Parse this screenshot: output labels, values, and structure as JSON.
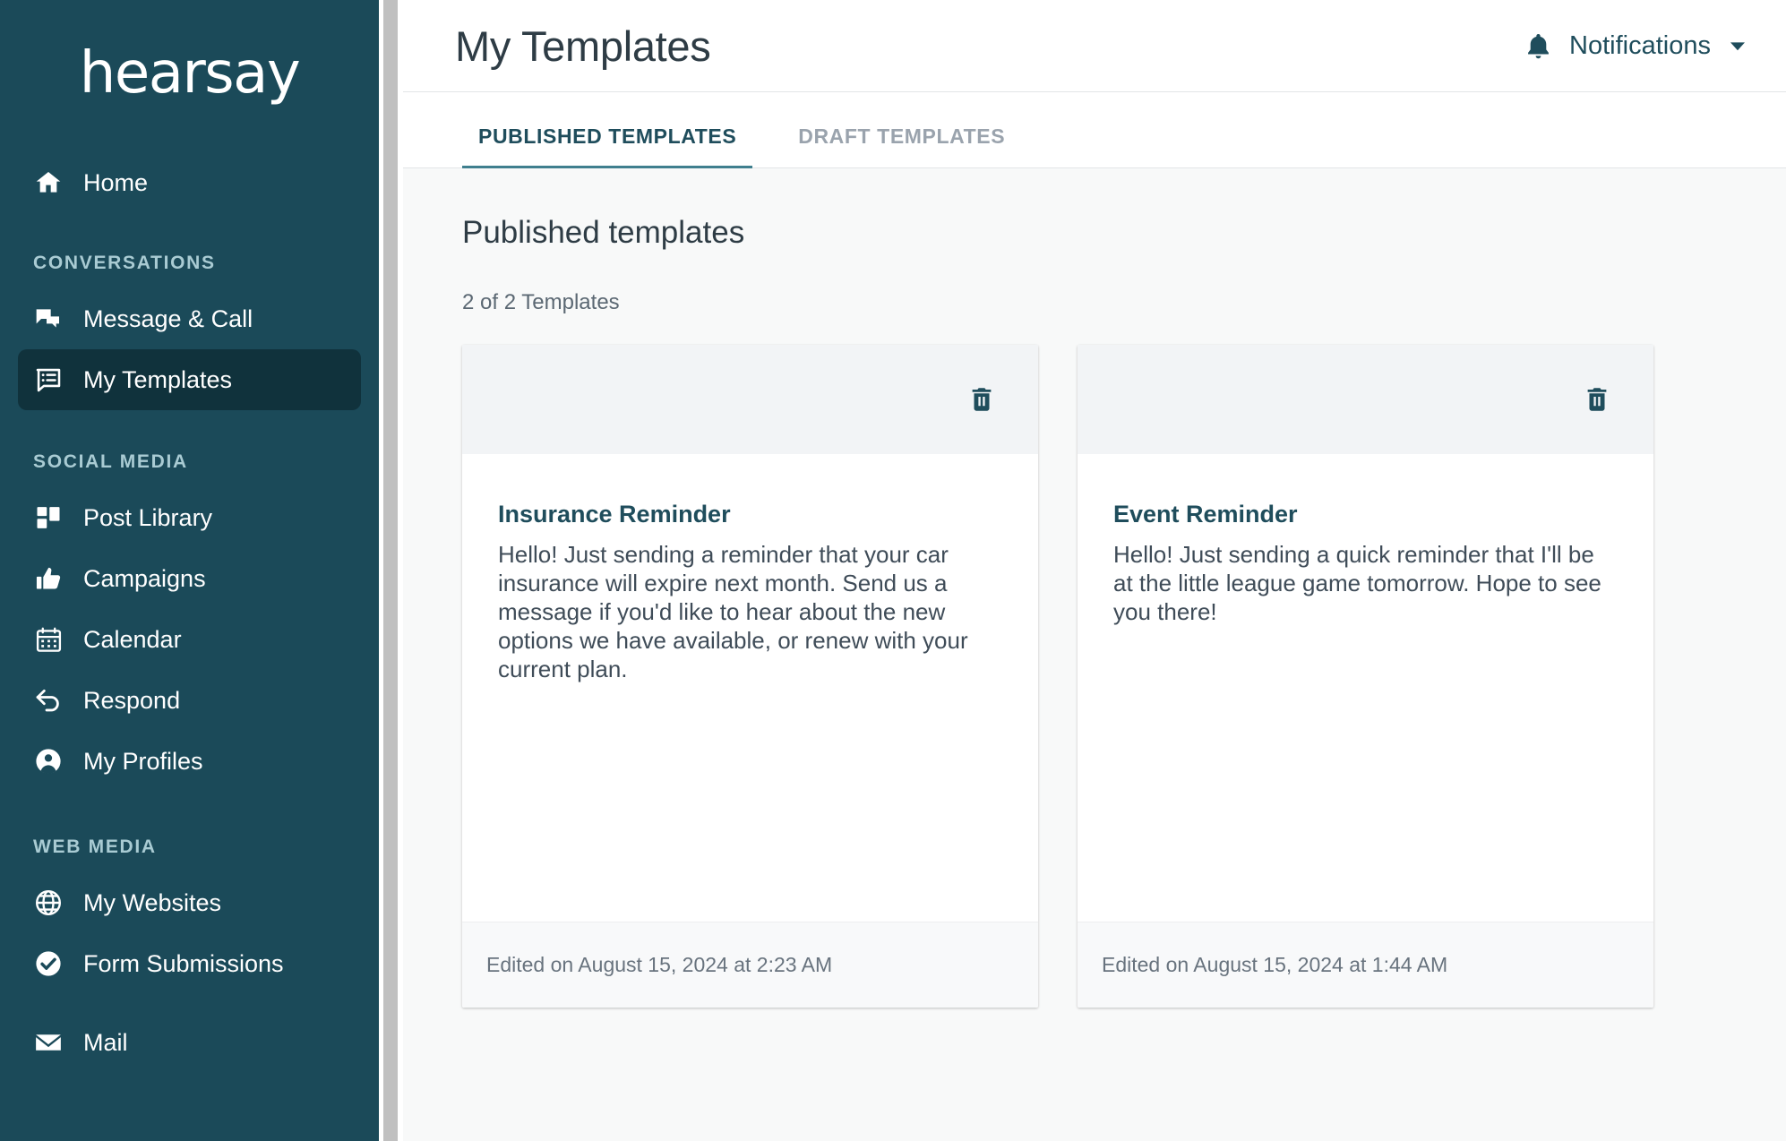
{
  "sidebar": {
    "logo": "hearsay",
    "nav": [
      {
        "label": "Home",
        "icon": "home-icon",
        "active": false
      },
      {
        "label": "Message & Call",
        "icon": "message-call-icon",
        "active": false
      },
      {
        "label": "My Templates",
        "icon": "templates-icon",
        "active": true
      },
      {
        "label": "Post Library",
        "icon": "post-library-icon",
        "active": false
      },
      {
        "label": "Campaigns",
        "icon": "thumbs-up-icon",
        "active": false
      },
      {
        "label": "Calendar",
        "icon": "calendar-icon",
        "active": false
      },
      {
        "label": "Respond",
        "icon": "reply-arrow-icon",
        "active": false
      },
      {
        "label": "My Profiles",
        "icon": "user-circle-icon",
        "active": false
      },
      {
        "label": "My Websites",
        "icon": "globe-icon",
        "active": false
      },
      {
        "label": "Form Submissions",
        "icon": "check-circle-icon",
        "active": false
      },
      {
        "label": "Mail",
        "icon": "envelope-icon",
        "active": false
      }
    ],
    "sections": {
      "conversations": "CONVERSATIONS",
      "social_media": "SOCIAL MEDIA",
      "web_media": "WEB MEDIA"
    }
  },
  "header": {
    "title": "My Templates",
    "notifications_label": "Notifications",
    "bell_icon": "bell-icon",
    "caret_icon": "chevron-down-icon"
  },
  "tabs": [
    {
      "label": "PUBLISHED TEMPLATES",
      "active": true
    },
    {
      "label": "DRAFT TEMPLATES",
      "active": false
    }
  ],
  "main": {
    "section_title": "Published templates",
    "count_text": "2 of 2 Templates",
    "cards": [
      {
        "title": "Insurance Reminder",
        "body": "Hello! Just sending a reminder that your car insurance will expire next month. Send us a message if you'd like to hear about the new options we have available, or renew with your current plan.",
        "footer": "Edited on August 15, 2024 at 2:23 AM",
        "delete_icon": "trash-icon"
      },
      {
        "title": "Event Reminder",
        "body": "Hello! Just sending a quick reminder that I'll be at the little league game tomorrow. Hope to see you there!",
        "footer": "Edited on August 15, 2024 at 1:44 AM",
        "delete_icon": "trash-icon"
      }
    ]
  },
  "colors": {
    "sidebar_bg": "#1b4a59",
    "sidebar_active": "#10323c",
    "section_label": "#a9cbd3",
    "accent_teal": "#3f7f8e",
    "brand_dark": "#1f4d5c",
    "content_bg": "#f8f9f9",
    "card_head_bg": "#f2f4f6",
    "text_dark": "#2e3c45",
    "text_muted": "#68737e",
    "tab_inactive": "#9aa3ad"
  }
}
